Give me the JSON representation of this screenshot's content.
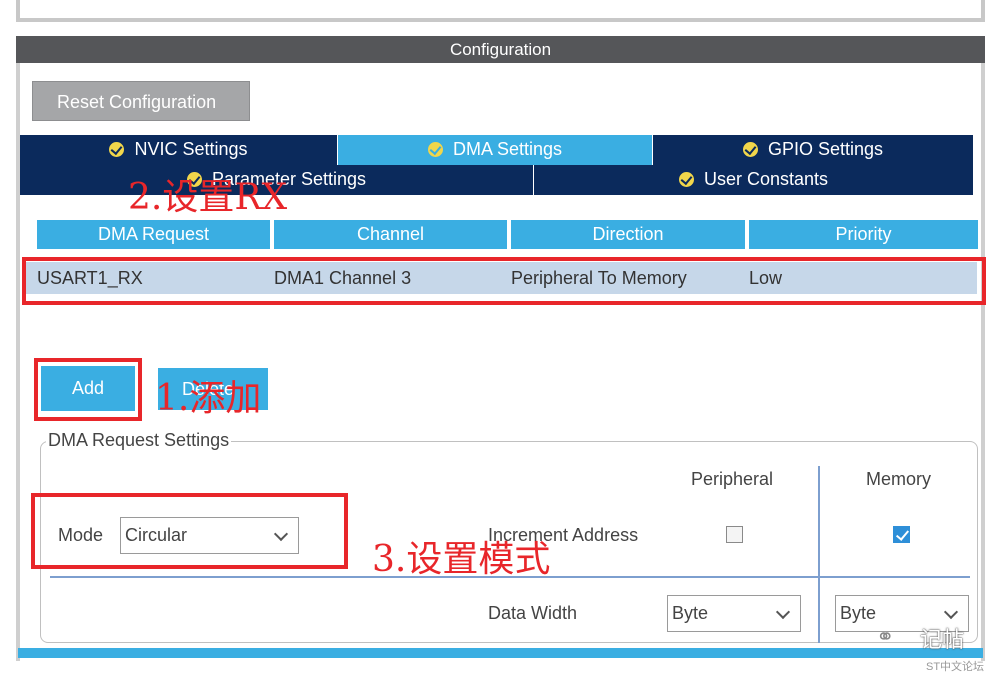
{
  "header": {
    "title": "Configuration"
  },
  "toolbar": {
    "reset_label": "Reset Configuration"
  },
  "tabs_row1": [
    {
      "label": "NVIC Settings",
      "active": false
    },
    {
      "label": "DMA Settings",
      "active": true
    },
    {
      "label": "GPIO Settings",
      "active": false
    }
  ],
  "tabs_row2": [
    {
      "label": "Parameter Settings",
      "active": false
    },
    {
      "label": "User Constants",
      "active": false
    }
  ],
  "table": {
    "columns": [
      "DMA Request",
      "Channel",
      "Direction",
      "Priority"
    ],
    "rows": [
      [
        "USART1_RX",
        "DMA1 Channel 3",
        "Peripheral To Memory",
        "Low"
      ]
    ]
  },
  "buttons": {
    "add": "Add",
    "delete": "Delete"
  },
  "request_settings": {
    "legend": "DMA Request Settings",
    "col_peripheral": "Peripheral",
    "col_memory": "Memory",
    "mode_label": "Mode",
    "mode_value": "Circular",
    "increment_label": "Increment Address",
    "peripheral_increment": false,
    "memory_increment": true,
    "data_width_label": "Data Width",
    "peripheral_width": "Byte",
    "memory_width": "Byte"
  },
  "annotations": {
    "step1": "1.添加",
    "step2": "2.设置RX",
    "step3": "3.设置模式"
  },
  "watermark": {
    "text": "记帖",
    "sub": "ST中文论坛"
  },
  "colors": {
    "accent": "#3aaee2",
    "navy": "#0b2a5c",
    "annotation_red": "#e8262a"
  }
}
